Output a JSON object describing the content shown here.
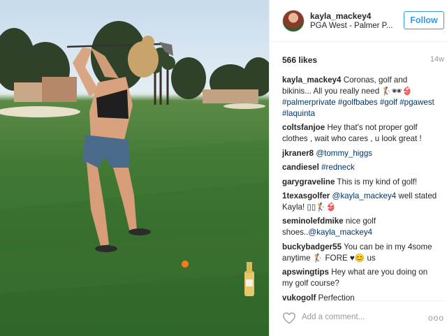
{
  "post": {
    "username": "kayla_mackey4",
    "location": "PGA West - Palmer P...",
    "follow_label": "Follow",
    "likes": "566 likes",
    "time_ago": "14w"
  },
  "comments": [
    {
      "author": "kayla_mackey4",
      "text": "Coronas, golf and bikinis... All you really need 🏌🕶👙",
      "tags": "#palmerprivate #golfbabes #golf #pgawest #laquinta"
    },
    {
      "author": "coltsfanjoe",
      "text": "Hey that's not proper golf clothes , wait who cares , u look great !",
      "tags": ""
    },
    {
      "author": "jkraner8",
      "text": "",
      "tags": "@tommy_higgs"
    },
    {
      "author": "candiesel",
      "text": "",
      "tags": "#redneck"
    },
    {
      "author": "garygraveline",
      "text": "This is my kind of golf!",
      "tags": ""
    },
    {
      "author": "1texasgolfer",
      "text_before": "",
      "tags": "@kayla_mackey4",
      "text_after": "well stated Kayla! ▯▯🏌👙"
    },
    {
      "author": "seminolefdmike",
      "text": "nice golf shoes..",
      "tags": "@kayla_mackey4"
    },
    {
      "author": "buckybadger55",
      "text": "You can be in my 4some anytime 🏌 FORE ♥😊 us",
      "tags": ""
    },
    {
      "author": "apswingtips",
      "text": "Hey what are you doing on my golf course?",
      "tags": ""
    },
    {
      "author": "vukogolf",
      "text": "Perfection",
      "tags": ""
    }
  ],
  "footer": {
    "add_comment_placeholder": "Add a comment...",
    "more_label": "ooo"
  },
  "icons": {
    "like": "heart-outline-icon",
    "more": "more-options-icon"
  },
  "colors": {
    "accent": "#3897f0",
    "tag": "#003569",
    "muted": "#999999"
  }
}
